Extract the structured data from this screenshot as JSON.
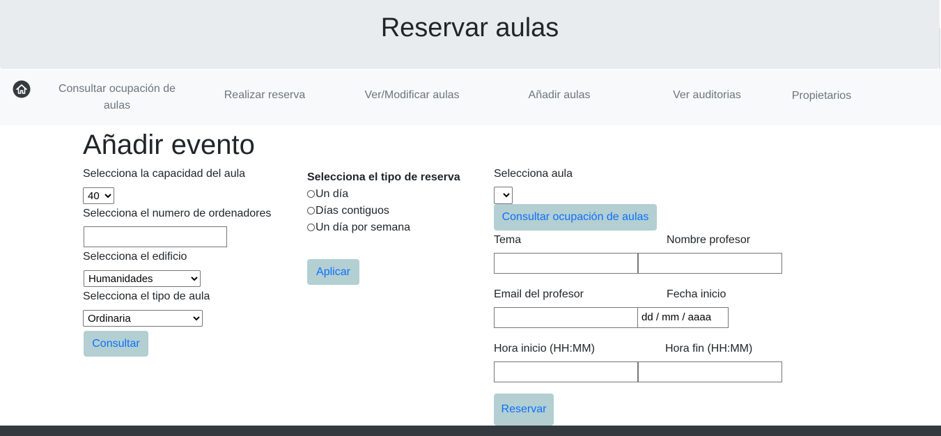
{
  "header": {
    "title": "Reservar aulas"
  },
  "nav": {
    "home_icon": "home-icon",
    "items": [
      {
        "label": "Consultar ocupación de aulas"
      },
      {
        "label": "Realizar reserva"
      },
      {
        "label": "Ver/Modificar aulas"
      },
      {
        "label": "Añadir aulas"
      },
      {
        "label": "Ver auditorias"
      },
      {
        "label": "Propietarios"
      }
    ]
  },
  "page_title": "Añadir evento",
  "left_form": {
    "capacity_label": "Selecciona la capacidad del aula",
    "capacity_value": "40",
    "computers_label": "Selecciona el numero de ordenadores",
    "computers_value": "",
    "building_label": "Selecciona el edificio",
    "building_value": "Humanidades",
    "room_type_label": "Selecciona el tipo de aula",
    "room_type_value": "Ordinaria",
    "submit_label": "Consultar"
  },
  "reservation_type": {
    "heading": "Selecciona el tipo de reserva",
    "options": [
      "Un día",
      "Días contiguos",
      "Un día por semana"
    ],
    "apply_label": "Aplicar"
  },
  "right_form": {
    "room_label": "Selecciona aula",
    "room_value": "",
    "check_button_label": "Consultar ocupación de aulas",
    "topic_label": "Tema",
    "teacher_name_label": "Nombre profesor",
    "teacher_email_label": "Email del profesor",
    "start_date_label": "Fecha inicio",
    "start_date_placeholder": "dd / mm / aaaa",
    "start_time_label": "Hora inicio (HH:MM)",
    "end_time_label": "Hora fin (HH:MM)",
    "reserve_label": "Reservar"
  },
  "colors": {
    "header_bg": "#e9ecef",
    "nav_bg": "#f8f9fa",
    "button_bg": "#b3cfd2",
    "button_text": "#0d6efd",
    "footer_bg": "#343a40"
  }
}
